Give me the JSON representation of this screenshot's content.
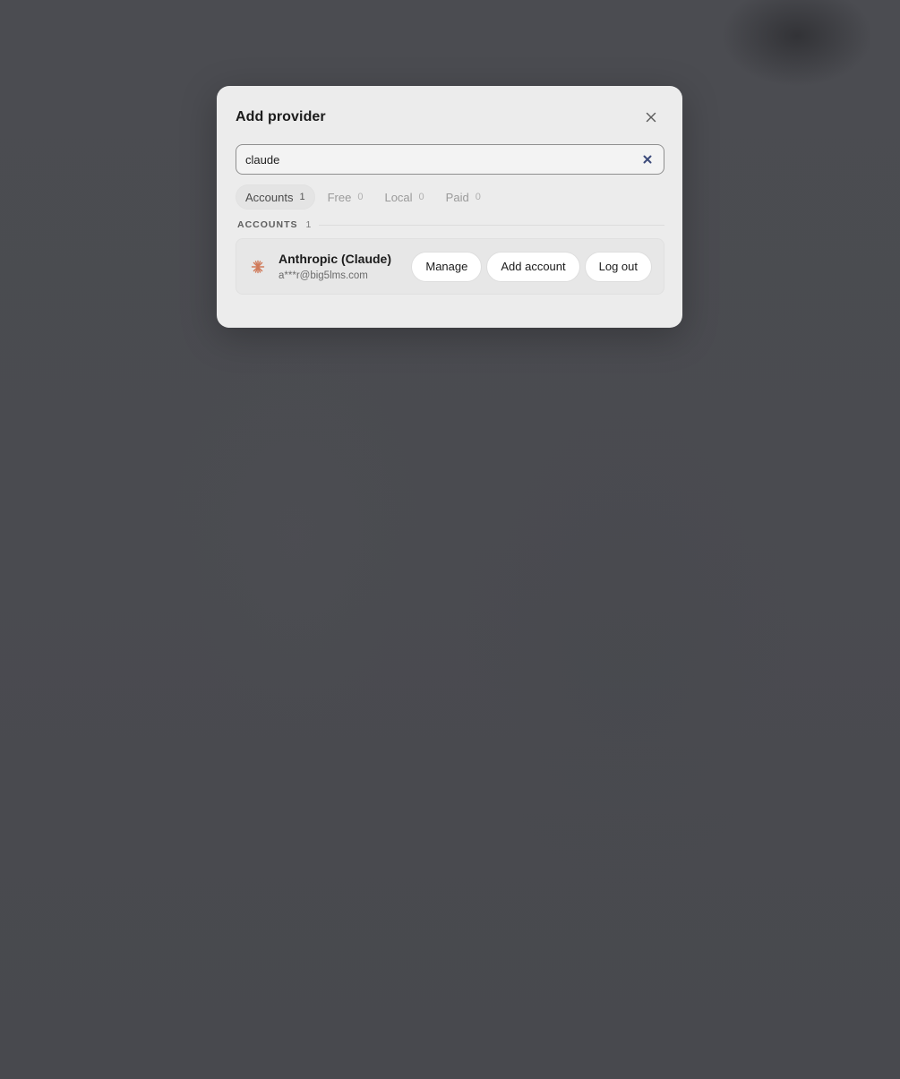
{
  "modal": {
    "title": "Add provider"
  },
  "search": {
    "value": "claude",
    "placeholder": ""
  },
  "tabs": [
    {
      "label": "Accounts",
      "count": "1",
      "active": true
    },
    {
      "label": "Free",
      "count": "0",
      "active": false
    },
    {
      "label": "Local",
      "count": "0",
      "active": false
    },
    {
      "label": "Paid",
      "count": "0",
      "active": false
    }
  ],
  "section": {
    "title": "ACCOUNTS",
    "count": "1"
  },
  "account": {
    "name": "Anthropic (Claude)",
    "email": "a***r@big5lms.com",
    "icon": "claude-asterisk-icon",
    "actions": {
      "manage": "Manage",
      "add_account": "Add account",
      "log_out": "Log out"
    }
  },
  "colors": {
    "backdrop": "#4a4b50",
    "modal_bg": "#ececec",
    "clear_icon": "#3b4a7a",
    "claude_icon": "#d07a5a"
  }
}
